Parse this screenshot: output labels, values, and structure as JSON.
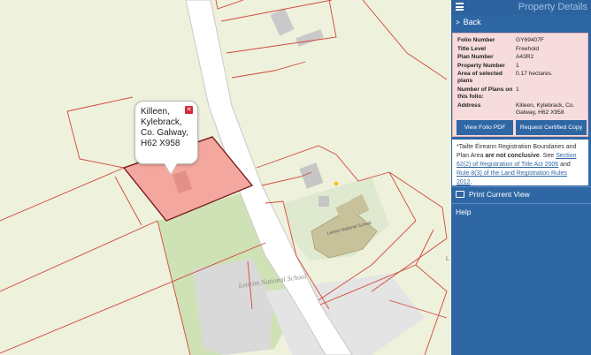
{
  "map": {
    "popup": {
      "text": "Killeen,\nKylebrack,\nCo. Galway,\nH62 X958",
      "close_icon": "close-icon"
    },
    "road_label": "Leitrim National School",
    "building_label": "Leitrim National School",
    "edge_label": "L",
    "colors": {
      "parcel_fill": "#f4a79e",
      "field_green": "#cfe2b6",
      "road": "#ffffff",
      "boundary": "#d2473b"
    }
  },
  "panel": {
    "title": "Property Details",
    "back_label": "Back",
    "details": [
      {
        "key": "Folio Number",
        "value": "GY69407F"
      },
      {
        "key": "Title Level",
        "value": "Freehold"
      },
      {
        "key": "Plan Number",
        "value": "A43R2"
      },
      {
        "key": "Property Number",
        "value": "1"
      },
      {
        "key": "Area of selected plans",
        "value": "0.17 hectares."
      },
      {
        "key": "Number of Plans on this folio:",
        "value": "1"
      },
      {
        "key": "Address",
        "value": "Killeen, Kylebrack, Co. Galway, H62 X958"
      }
    ],
    "buttons": {
      "view_pdf": "View Folio PDF",
      "request_copy": "Request Certified Copy"
    },
    "note": {
      "prefix": "*Tailte Éireann Registration Boundaries and Plan Area ",
      "bold": "are not conclusive",
      "middle": ". See ",
      "link1": "Section 62(2) of Registration of Title Act 2006",
      "and": " and ",
      "link2": "Rule 8(3) of the Land Registration Rules 2012",
      "suffix": "."
    },
    "print_label": "Print Current View",
    "help_label": "Help",
    "colors": {
      "panel_bg": "#2f67a4",
      "details_bg": "#f6dcdc"
    }
  }
}
